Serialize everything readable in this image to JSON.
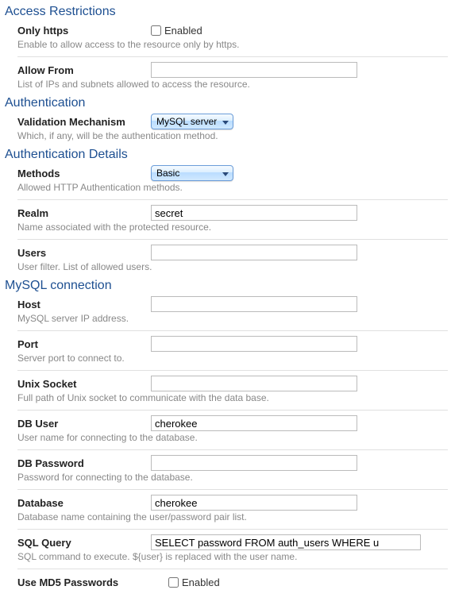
{
  "section_access": {
    "title": "Access Restrictions",
    "only_https": {
      "label": "Only https",
      "checkbox_label": "Enabled",
      "desc": "Enable to allow access to the resource only by https.",
      "checked": false
    },
    "allow_from": {
      "label": "Allow From",
      "value": "",
      "desc": "List of IPs and subnets allowed to access the resource."
    }
  },
  "section_auth": {
    "title": "Authentication",
    "validation": {
      "label": "Validation Mechanism",
      "value": "MySQL server",
      "desc": "Which, if any, will be the authentication method."
    }
  },
  "section_auth_details": {
    "title": "Authentication Details",
    "methods": {
      "label": "Methods",
      "value": "Basic",
      "desc": "Allowed HTTP Authentication methods."
    },
    "realm": {
      "label": "Realm",
      "value": "secret",
      "desc": "Name associated with the protected resource."
    },
    "users": {
      "label": "Users",
      "value": "",
      "desc": "User filter. List of allowed users."
    }
  },
  "section_mysql": {
    "title": "MySQL connection",
    "host": {
      "label": "Host",
      "value": "",
      "desc": "MySQL server IP address."
    },
    "port": {
      "label": "Port",
      "value": "",
      "desc": "Server port to connect to."
    },
    "unix_socket": {
      "label": "Unix Socket",
      "value": "",
      "desc": "Full path of Unix socket to communicate with the data base."
    },
    "db_user": {
      "label": "DB User",
      "value": "cherokee",
      "desc": "User name for connecting to the database."
    },
    "db_password": {
      "label": "DB Password",
      "value": "",
      "desc": "Password for connecting to the database."
    },
    "database": {
      "label": "Database",
      "value": "cherokee",
      "desc": "Database name containing the user/password pair list."
    },
    "sql_query": {
      "label": "SQL Query",
      "value": "SELECT password FROM auth_users WHERE u",
      "desc": "SQL command to execute. ${user} is replaced with the user name."
    },
    "use_md5": {
      "label": "Use MD5 Passwords",
      "checkbox_label": "Enabled",
      "checked": false
    }
  }
}
